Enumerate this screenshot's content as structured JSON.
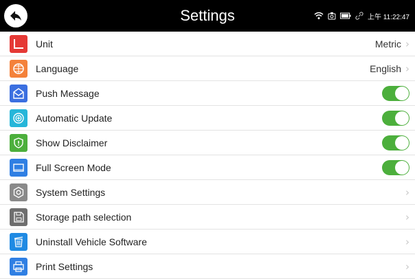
{
  "header": {
    "title": "Settings",
    "time": "上午 11:22:47",
    "status_icons": [
      "wifi-icon",
      "screenshot-icon",
      "battery-icon",
      "link-icon"
    ]
  },
  "rows": [
    {
      "label": "Unit",
      "value": "Metric",
      "icon": "unit-icon",
      "color": "#e53935"
    },
    {
      "label": "Language",
      "value": "English",
      "icon": "language-icon",
      "color": "#f4813a"
    },
    {
      "label": "Push Message",
      "value": "on",
      "icon": "push-message-icon",
      "color": "#3b6fe0"
    },
    {
      "label": "Automatic Update",
      "value": "on",
      "icon": "update-icon",
      "color": "#26b6d9"
    },
    {
      "label": "Show Disclaimer",
      "value": "on",
      "icon": "disclaimer-icon",
      "color": "#4caf3c"
    },
    {
      "label": "Full Screen Mode",
      "value": "on",
      "icon": "fullscreen-icon",
      "color": "#2f7fe3"
    },
    {
      "label": "System Settings",
      "icon": "gear-icon",
      "color": "#8a8a8a"
    },
    {
      "label": "Storage path selection",
      "icon": "storage-icon",
      "color": "#6e6e6e"
    },
    {
      "label": "Uninstall Vehicle Software",
      "icon": "trash-icon",
      "color": "#1f8ae3"
    },
    {
      "label": "Print Settings",
      "icon": "print-icon",
      "color": "#2f7fe3"
    }
  ],
  "toggle_color": "#4caf3c"
}
